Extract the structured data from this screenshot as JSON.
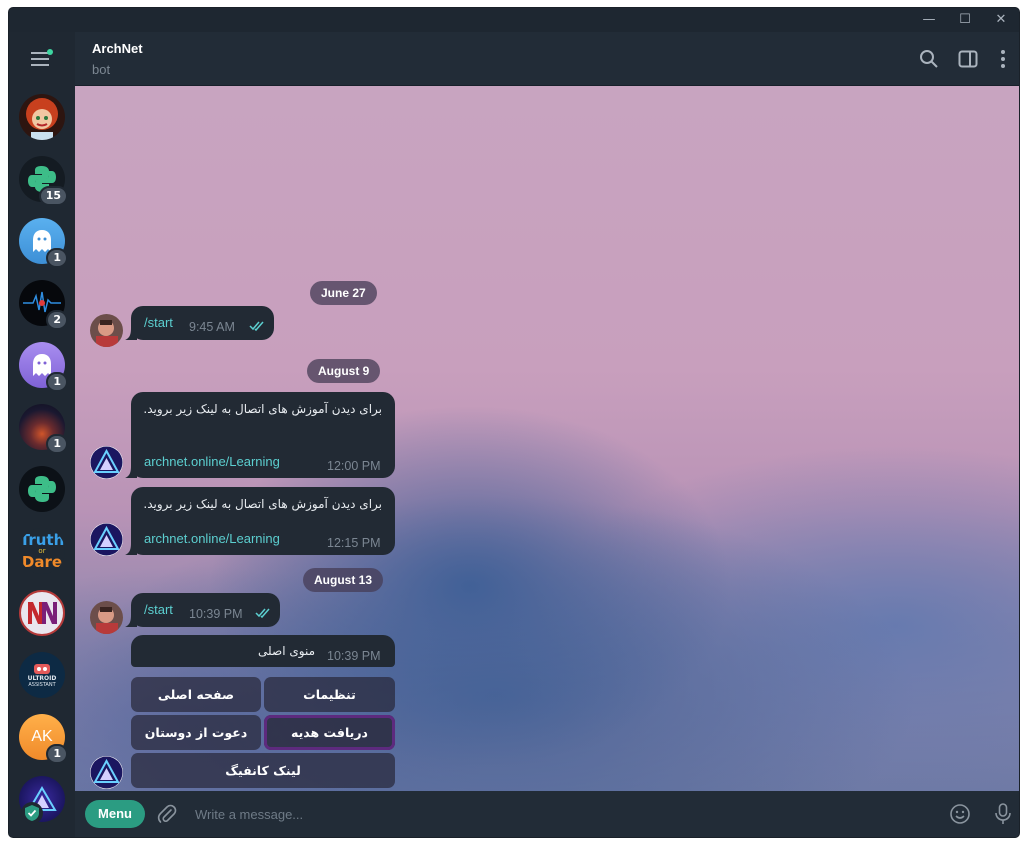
{
  "window": {
    "minimize_glyph": "—",
    "maximize_glyph": "☐",
    "close_glyph": "✕"
  },
  "sidebar": {
    "chats": [
      {
        "name": "chat-avatar-woman",
        "badge": ""
      },
      {
        "name": "chat-avatar-python",
        "badge": "15"
      },
      {
        "name": "chat-avatar-ghost-blue",
        "badge": "1"
      },
      {
        "name": "chat-avatar-wave",
        "badge": "2"
      },
      {
        "name": "chat-avatar-ghost-purple",
        "badge": "1"
      },
      {
        "name": "chat-avatar-night",
        "badge": "1"
      },
      {
        "name": "chat-avatar-python-2",
        "badge": ""
      },
      {
        "name": "chat-avatar-truth-or-dare",
        "badge": "",
        "logo_text": [
          "Truth",
          "or",
          "Dare"
        ]
      },
      {
        "name": "chat-avatar-nn",
        "badge": ""
      },
      {
        "name": "chat-avatar-ultroid",
        "badge": "",
        "logo_text": [
          "ULTROID",
          "ASSISTANT"
        ]
      },
      {
        "name": "chat-avatar-ak",
        "badge": "1",
        "initials": "AK"
      },
      {
        "name": "chat-avatar-archnet",
        "badge": ""
      }
    ]
  },
  "header": {
    "title": "ArchNet",
    "subtitle": "bot"
  },
  "messages": {
    "date1": "June 27",
    "msg1_text": "/start",
    "msg1_time": "9:45 AM",
    "date2": "August 9",
    "msg2_text": "برای دیدن آموزش های اتصال به لینک زیر بروید.",
    "msg2_link": "archnet.online/Learning",
    "msg2_time": "12:00 PM",
    "msg3_text": "برای دیدن آموزش های اتصال به لینک زیر بروید.",
    "msg3_link": "archnet.online/Learning",
    "msg3_time": "12:15 PM",
    "date3": "August 13",
    "msg4_text": "/start",
    "msg4_time": "10:39 PM",
    "msg5_text": "منوی اصلی",
    "msg5_time": "10:39 PM"
  },
  "keyboard": {
    "settings": "تنظیمات",
    "home": "صفحه اصلی",
    "gift": "دریافت هدیه",
    "invite": "دعوت از دوستان",
    "config": "لینک کانفیگ"
  },
  "composer": {
    "menu_label": "Menu",
    "placeholder": "Write a message..."
  },
  "colors": {
    "accent": "#2b9c82",
    "link": "#5ccfd0",
    "bubble": "#222a34",
    "selected_outline": "#5d2a7e"
  }
}
